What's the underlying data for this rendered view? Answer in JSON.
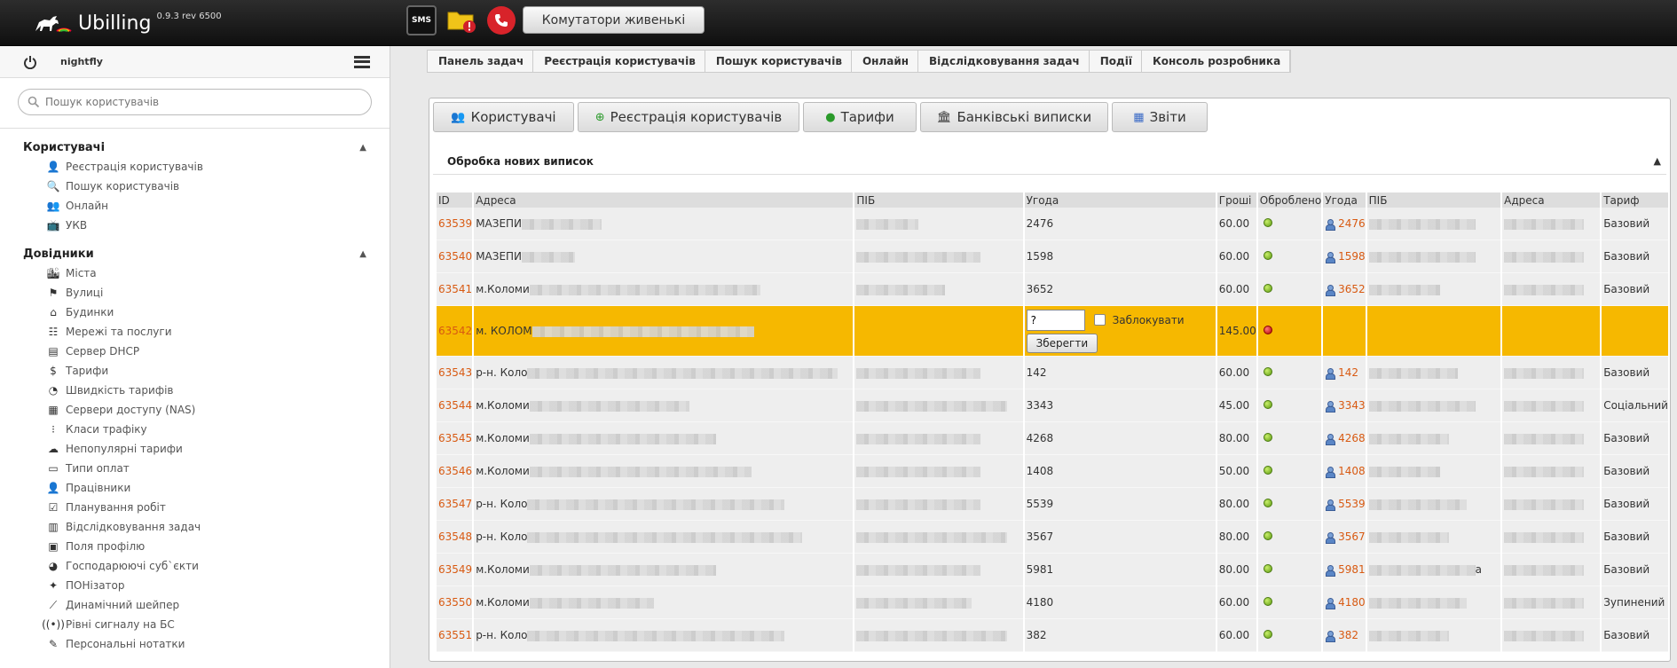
{
  "app": {
    "name": "Ubilling",
    "version": "0.9.3 rev 6500"
  },
  "topbar": {
    "sms_label": "SMS",
    "switches_button": "Комутатори живенькі"
  },
  "sidebar": {
    "username": "nightfly",
    "search_placeholder": "Пошук користувачів",
    "sections": [
      {
        "title": "Користувачі",
        "items": [
          "Реєстрація користувачів",
          "Пошук користувачів",
          "Онлайн",
          "УКВ"
        ]
      },
      {
        "title": "Довідники",
        "items": [
          "Міста",
          "Вулиці",
          "Будинки",
          "Мережі та послуги",
          "Сервер DHCP",
          "Тарифи",
          "Швидкість тарифів",
          "Сервери доступу (NAS)",
          "Класи трафіку",
          "Непопулярні тарифи",
          "Типи оплат",
          "Працівники",
          "Планування робіт",
          "Відслідковування задач",
          "Поля профілю",
          "Господарюючі суб`єкти",
          "ПОНізатор",
          "Динамічний шейпер",
          "Рівні сигналу на БС",
          "Персональні нотатки"
        ]
      }
    ]
  },
  "breadcrumbs": [
    "Панель задач",
    "Реєстрація користувачів",
    "Пошук користувачів",
    "Онлайн",
    "Відслідковування задач",
    "Події",
    "Консоль розробника"
  ],
  "tabs": [
    "Користувачі",
    "Реєстрація користувачів",
    "Тарифи",
    "Банківські виписки",
    "Звіти"
  ],
  "section_title": "Обробка нових виписок",
  "table": {
    "headers": [
      "ID",
      "Адреса",
      "ПІБ",
      "Угода",
      "Гроші",
      "Оброблено",
      "Угода",
      "ПІБ",
      "Адреса",
      "Тариф"
    ],
    "rows": [
      {
        "id": "63539",
        "addr": "МАЗЕПИ",
        "contract": "2476",
        "money": "60.00",
        "status": "ok",
        "ucontract": "2476",
        "tariff": "Базовий"
      },
      {
        "id": "63540",
        "addr": "МАЗЕПИ",
        "contract": "1598",
        "money": "60.00",
        "status": "ok",
        "ucontract": "1598",
        "tariff": "Базовий"
      },
      {
        "id": "63541",
        "addr": "м.Коломи",
        "contract": "3652",
        "money": "60.00",
        "status": "ok",
        "ucontract": "3652",
        "tariff": "Базовий"
      },
      {
        "id": "63542",
        "addr": "м. КОЛОМ",
        "contract": "",
        "money": "145.00",
        "status": "error",
        "ucontract": "",
        "tariff": "",
        "highlight": true,
        "input_value": "?",
        "lock_label": "Заблокувати",
        "save_label": "Зберегти"
      },
      {
        "id": "63543",
        "addr": "р-н. Коло",
        "contract": "142",
        "money": "60.00",
        "status": "ok",
        "ucontract": "142",
        "tariff": "Базовий"
      },
      {
        "id": "63544",
        "addr": "м.Коломи",
        "contract": "3343",
        "money": "45.00",
        "status": "ok",
        "ucontract": "3343",
        "tariff": "Соціальний"
      },
      {
        "id": "63545",
        "addr": "м.Коломи",
        "contract": "4268",
        "money": "80.00",
        "status": "ok",
        "ucontract": "4268",
        "tariff": "Базовий"
      },
      {
        "id": "63546",
        "addr": "м.Коломи",
        "contract": "1408",
        "money": "50.00",
        "status": "ok",
        "ucontract": "1408",
        "tariff": "Базовий"
      },
      {
        "id": "63547",
        "addr": "р-н. Коло",
        "contract": "5539",
        "money": "80.00",
        "status": "ok",
        "ucontract": "5539",
        "tariff": "Базовий"
      },
      {
        "id": "63548",
        "addr": "р-н. Коло",
        "contract": "3567",
        "money": "80.00",
        "status": "ok",
        "ucontract": "3567",
        "tariff": "Базовий"
      },
      {
        "id": "63549",
        "addr": "м.Коломи",
        "contract": "5981",
        "money": "80.00",
        "status": "ok",
        "ucontract": "5981",
        "tariff": "Базовий",
        "name_suffix": "а"
      },
      {
        "id": "63550",
        "addr": "м.Коломи",
        "contract": "4180",
        "money": "60.00",
        "status": "ok",
        "ucontract": "4180",
        "tariff": "Зупинений"
      },
      {
        "id": "63551",
        "addr": "р-н. Коло",
        "contract": "382",
        "money": "60.00",
        "status": "ok",
        "ucontract": "382",
        "tariff": "Базовий"
      }
    ]
  },
  "colors": {
    "accent": "#d85a12",
    "highlight": "#f6b800",
    "status_ok": "#5e9b12",
    "status_error": "#b20000"
  }
}
